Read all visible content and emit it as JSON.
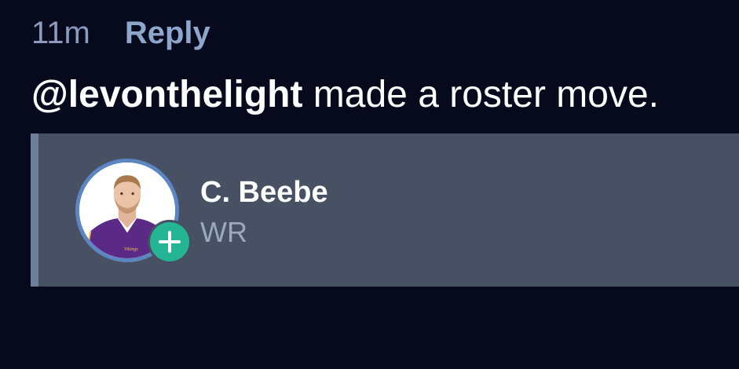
{
  "post": {
    "timestamp": "11m",
    "reply_label": "Reply",
    "handle": "@levonthelight",
    "message_text": " made a roster move."
  },
  "roster_card": {
    "player_name": "C. Beebe",
    "position": "WR",
    "action_icon": "plus-icon",
    "team_jersey_text": "Vikings"
  },
  "colors": {
    "background": "#060a1c",
    "card_background": "#475163",
    "accent_border": "#6e7f9b",
    "add_badge": "#25b494",
    "avatar_ring": "#5c86c2"
  }
}
